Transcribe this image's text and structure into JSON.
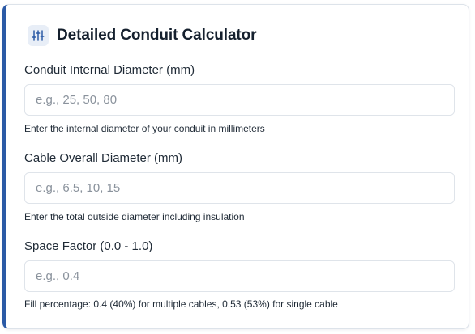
{
  "calculator": {
    "title": "Detailed Conduit Calculator",
    "header_icon": "sliders-icon",
    "accent_color": "#2b5aa6",
    "fields": [
      {
        "label": "Conduit Internal Diameter (mm)",
        "value": "",
        "placeholder": "e.g., 25, 50, 80",
        "help": "Enter the internal diameter of your conduit in millimeters"
      },
      {
        "label": "Cable Overall Diameter (mm)",
        "value": "",
        "placeholder": "e.g., 6.5, 10, 15",
        "help": "Enter the total outside diameter including insulation"
      },
      {
        "label": "Space Factor (0.0 - 1.0)",
        "value": "",
        "placeholder": "e.g., 0.4",
        "help": "Fill percentage: 0.4 (40%) for multiple cables, 0.53 (53%) for single cable"
      }
    ]
  }
}
